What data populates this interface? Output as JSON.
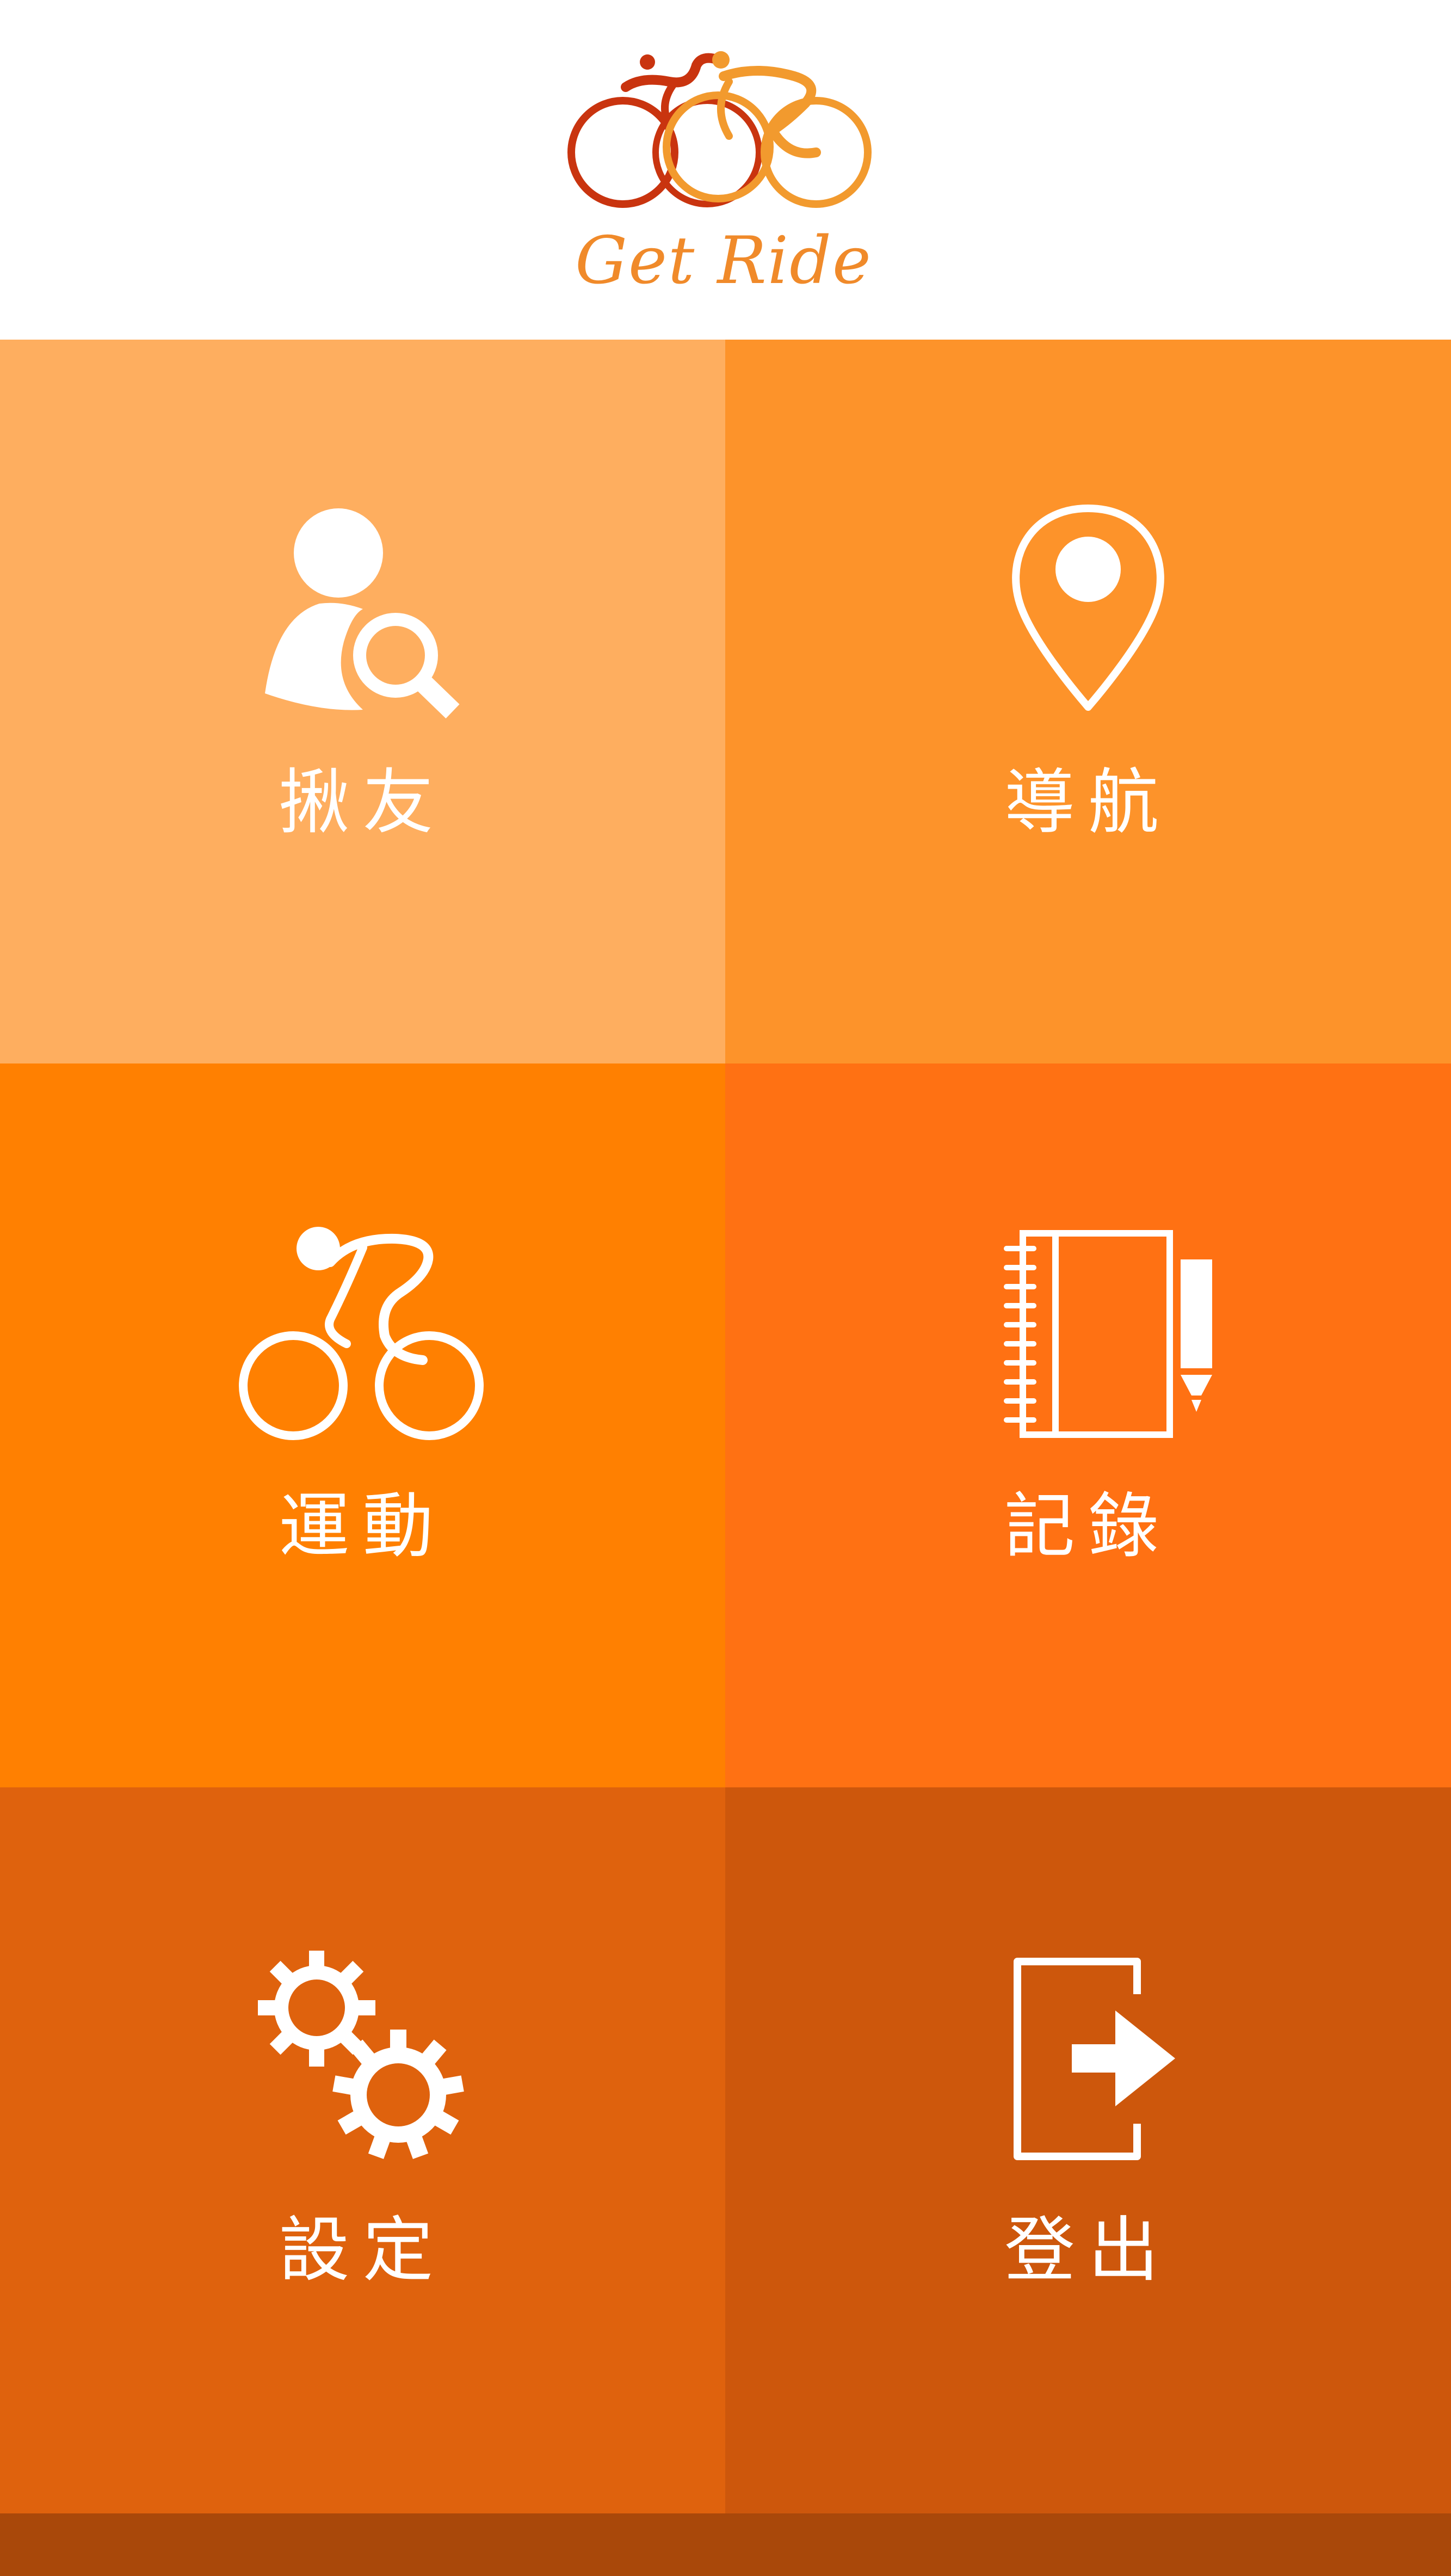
{
  "app": {
    "logo_text": "Get Ride"
  },
  "colors": {
    "header_bg": "#ffffff",
    "tile_find_friend": "#feae5f",
    "tile_navigation": "#fd932a",
    "tile_exercise": "#ff8001",
    "tile_records": "#ff7113",
    "tile_settings": "#df620d",
    "tile_logout": "#cd570c",
    "footer_bar": "#a9480a",
    "logo_red": "#c9340f",
    "logo_orange": "#f29a2e"
  },
  "menu": {
    "find_friend": {
      "label": "揪友",
      "icon": "user-search-icon"
    },
    "navigation": {
      "label": "導航",
      "icon": "map-pin-icon"
    },
    "exercise": {
      "label": "運動",
      "icon": "cyclist-icon"
    },
    "records": {
      "label": "記錄",
      "icon": "notebook-pen-icon"
    },
    "settings": {
      "label": "設定",
      "icon": "gears-icon"
    },
    "logout": {
      "label": "登出",
      "icon": "logout-door-icon"
    }
  }
}
